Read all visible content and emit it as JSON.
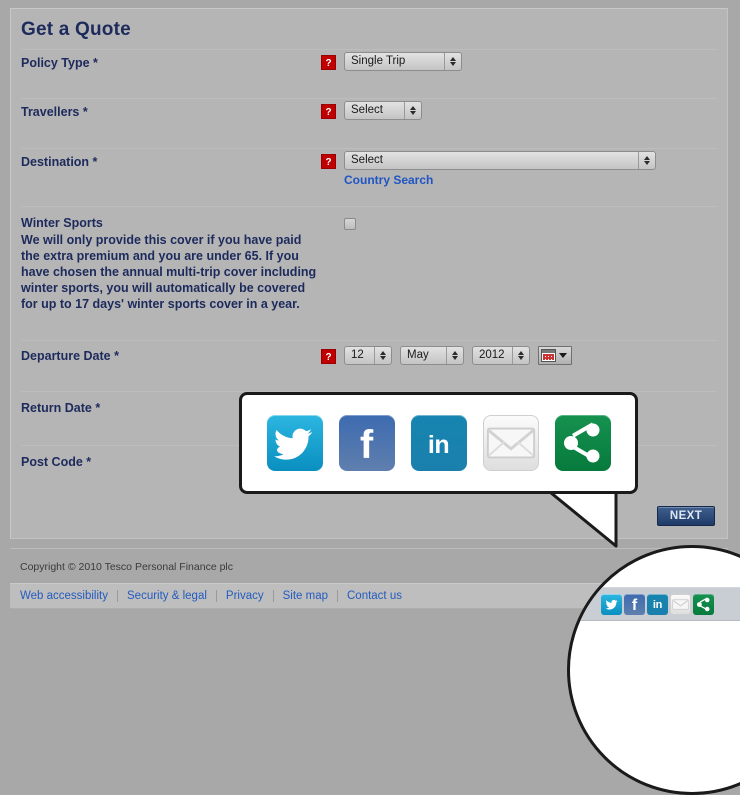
{
  "page": {
    "title": "Get a Quote"
  },
  "form": {
    "rows": [
      {
        "id": "policy-type",
        "label": "Policy Type *",
        "help": "?",
        "value": "Single Trip"
      },
      {
        "id": "travellers",
        "label": "Travellers *",
        "help": "?",
        "value": "Select"
      },
      {
        "id": "destination",
        "label": "Destination *",
        "help": "?",
        "value": "Select",
        "link": "Country Search"
      },
      {
        "id": "winter-sports",
        "label": "Winter Sports",
        "description": "We will only provide this cover if you have paid the extra premium and you are under 65. If you have chosen the annual multi-trip cover including winter sports, you will automatically be covered for up to 17 days' winter sports cover in a year."
      },
      {
        "id": "departure-date",
        "label": "Departure Date *",
        "help": "?",
        "day": "12",
        "month": "May",
        "year": "2012"
      },
      {
        "id": "return-date",
        "label": "Return Date *"
      },
      {
        "id": "post-code",
        "label": "Post Code *"
      }
    ],
    "next_label": "NEXT"
  },
  "footer": {
    "copyright": "Copyright © 2010 Tesco Personal Finance plc",
    "links": [
      "Web accessibility",
      "Security & legal",
      "Privacy",
      "Site map",
      "Contact us"
    ]
  },
  "share": {
    "items": [
      {
        "name": "twitter",
        "label": ""
      },
      {
        "name": "facebook",
        "label": "f"
      },
      {
        "name": "linkedin",
        "label": "in"
      },
      {
        "name": "email",
        "label": ""
      },
      {
        "name": "share",
        "label": ""
      }
    ]
  },
  "colors": {
    "page_background": "#a8a8a8",
    "panel_background": "#b5b5b5",
    "heading": "#1d2a5c",
    "link": "#245bbf",
    "help_badge": "#c00000",
    "next_button": "#1e3a67",
    "twitter": "#0a8fc0",
    "facebook": "#3d6bb0",
    "linkedin": "#1b7fad",
    "email": "#dedede",
    "share": "#067a3c"
  }
}
